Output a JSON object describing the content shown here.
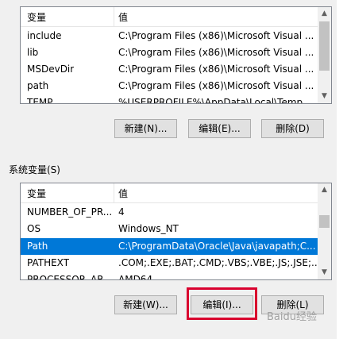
{
  "user_vars": {
    "header": {
      "name": "变量",
      "value": "值"
    },
    "rows": [
      {
        "name": "include",
        "value": "C:\\Program Files (x86)\\Microsoft Visual ..."
      },
      {
        "name": "lib",
        "value": "C:\\Program Files (x86)\\Microsoft Visual ..."
      },
      {
        "name": "MSDevDir",
        "value": "C:\\Program Files (x86)\\Microsoft Visual ..."
      },
      {
        "name": "path",
        "value": "C:\\Program Files (x86)\\Microsoft Visual ..."
      },
      {
        "name": "TEMP",
        "value": "%USERPROFILE%\\AppData\\Local\\Temp"
      }
    ],
    "buttons": {
      "new": "新建(N)...",
      "edit": "编辑(E)...",
      "delete": "删除(D)"
    }
  },
  "system_vars": {
    "label": "系统变量(S)",
    "header": {
      "name": "变量",
      "value": "值"
    },
    "rows": [
      {
        "name": "NUMBER_OF_PR...",
        "value": "4"
      },
      {
        "name": "OS",
        "value": "Windows_NT"
      },
      {
        "name": "Path",
        "value": "C:\\ProgramData\\Oracle\\Java\\javapath;C..."
      },
      {
        "name": "PATHEXT",
        "value": ".COM;.EXE;.BAT;.CMD;.VBS;.VBE;.JS;.JSE;..."
      },
      {
        "name": "PROCESSOR_AR...",
        "value": "AMD64"
      }
    ],
    "selected_index": 2,
    "buttons": {
      "new": "新建(W)...",
      "edit": "编辑(I)...",
      "delete": "删除(L)"
    }
  },
  "watermark": "Baidu经验",
  "colors": {
    "selection": "#0078d7",
    "highlight": "#d9002e"
  }
}
